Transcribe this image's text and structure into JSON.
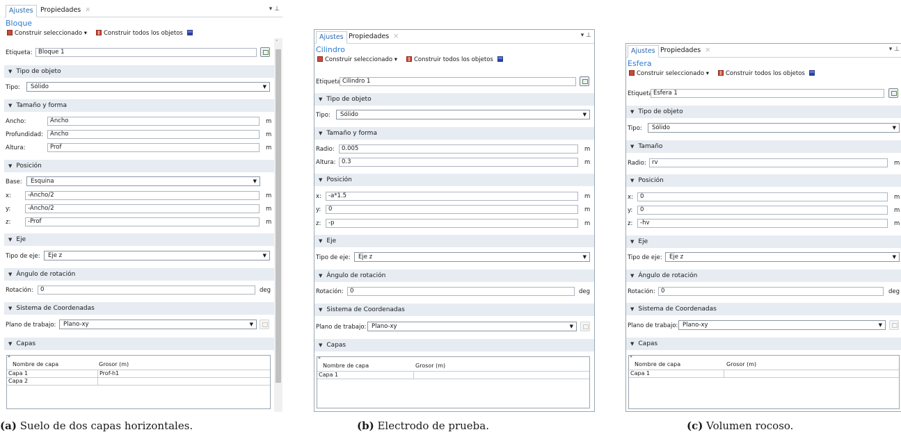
{
  "panels": [
    {
      "tab_active": "Ajustes",
      "tab_other": "Propiedades",
      "title": "Bloque",
      "build_selected": "Construir seleccionado",
      "build_all": "Construir todos los objetos",
      "label_caption": "Etiqueta:",
      "label_value": "Bloque 1",
      "sec_type": "Tipo de objeto",
      "type_caption": "Tipo:",
      "type_value": "Sólido",
      "sec_size": "Tamaño y forma",
      "size_fields": [
        {
          "label": "Ancho:",
          "value": "Ancho",
          "unit": "m"
        },
        {
          "label": "Profundidad:",
          "value": "Ancho",
          "unit": "m"
        },
        {
          "label": "Altura:",
          "value": "Prof",
          "unit": "m"
        }
      ],
      "sec_pos": "Posición",
      "base_caption": "Base:",
      "base_value": "Esquina",
      "pos_fields": [
        {
          "label": "x:",
          "value": "-Ancho/2",
          "unit": "m"
        },
        {
          "label": "y:",
          "value": "-Ancho/2",
          "unit": "m"
        },
        {
          "label": "z:",
          "value": "-Prof",
          "unit": "m"
        }
      ],
      "sec_axis": "Eje",
      "axis_caption": "Tipo de eje:",
      "axis_value": "Eje z",
      "sec_rot": "Ángulo de rotación",
      "rot_caption": "Rotación:",
      "rot_value": "0",
      "rot_unit": "deg",
      "sec_coord": "Sistema de Coordenadas",
      "plane_caption": "Plano de trabajo:",
      "plane_value": "Plano-xy",
      "sec_layers": "Capas",
      "col_name": "Nombre de capa",
      "col_thick": "Grosor (m)",
      "layers": [
        {
          "name": "Capa 1",
          "thick": "Prof-h1"
        },
        {
          "name": "Capa 2",
          "thick": ""
        }
      ]
    },
    {
      "tab_active": "Ajustes",
      "tab_other": "Propiedades",
      "title": "Cilindro",
      "build_selected": "Construir seleccionado",
      "build_all": "Construir todos los objetos",
      "label_caption": "Etiqueta:",
      "label_value": "Cilindro 1",
      "sec_type": "Tipo de objeto",
      "type_caption": "Tipo:",
      "type_value": "Sólido",
      "sec_size": "Tamaño y forma",
      "size_fields": [
        {
          "label": "Radio:",
          "value": "0.005",
          "unit": "m"
        },
        {
          "label": "Altura:",
          "value": "0.3",
          "unit": "m"
        }
      ],
      "sec_pos": "Posición",
      "pos_fields": [
        {
          "label": "x:",
          "value": "-a*1.5",
          "unit": "m"
        },
        {
          "label": "y:",
          "value": "0",
          "unit": "m"
        },
        {
          "label": "z:",
          "value": "-p",
          "unit": "m"
        }
      ],
      "sec_axis": "Eje",
      "axis_caption": "Tipo de eje:",
      "axis_value": "Eje z",
      "sec_rot": "Ángulo de rotación",
      "rot_caption": "Rotación:",
      "rot_value": "0",
      "rot_unit": "deg",
      "sec_coord": "Sistema de Coordenadas",
      "plane_caption": "Plano de trabajo:",
      "plane_value": "Plano-xy",
      "sec_layers": "Capas",
      "col_name": "Nombre de capa",
      "col_thick": "Grosor (m)",
      "layers": [
        {
          "name": "Capa 1",
          "thick": ""
        }
      ]
    },
    {
      "tab_active": "Ajustes",
      "tab_other": "Propiedades",
      "title": "Esfera",
      "build_selected": "Construir seleccionado",
      "build_all": "Construir todos los objetos",
      "label_caption": "Etiqueta:",
      "label_value": "Esfera 1",
      "sec_type": "Tipo de objeto",
      "type_caption": "Tipo:",
      "type_value": "Sólido",
      "sec_size": "Tamaño",
      "size_fields": [
        {
          "label": "Radio:",
          "value": "rv",
          "unit": "m"
        }
      ],
      "sec_pos": "Posición",
      "pos_fields": [
        {
          "label": "x:",
          "value": "0",
          "unit": "m"
        },
        {
          "label": "y:",
          "value": "0",
          "unit": "m"
        },
        {
          "label": "z:",
          "value": "-hv",
          "unit": "m"
        }
      ],
      "sec_axis": "Eje",
      "axis_caption": "Tipo de eje:",
      "axis_value": "Eje z",
      "sec_rot": "Ángulo de rotación",
      "rot_caption": "Rotación:",
      "rot_value": "0",
      "rot_unit": "deg",
      "sec_coord": "Sistema de Coordenadas",
      "plane_caption": "Plano de trabajo:",
      "plane_value": "Plano-xy",
      "sec_layers": "Capas",
      "col_name": "Nombre de capa",
      "col_thick": "Grosor (m)",
      "layers": [
        {
          "name": "Capa 1",
          "thick": ""
        }
      ]
    }
  ],
  "captions": [
    {
      "letter": "(a)",
      "text": "Suelo de dos capas horizontales."
    },
    {
      "letter": "(b)",
      "text": "Electrodo de prueba."
    },
    {
      "letter": "(c)",
      "text": "Volumen rocoso."
    }
  ]
}
